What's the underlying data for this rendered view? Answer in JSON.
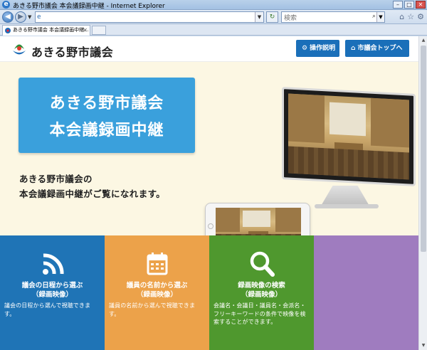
{
  "window": {
    "title": "あきる野市議会 本会議録画中継 - Internet Explorer",
    "buttons": {
      "minimize": "–",
      "maximize": "□",
      "close": "✕"
    }
  },
  "toolbar": {
    "back_label": "◀",
    "forward_label": "▶",
    "address_value": "",
    "search_placeholder": "検索",
    "tab_title": "あきる野市議会 本会議録画中継...",
    "icons": [
      "home-icon",
      "favorites-star-icon",
      "gear-icon"
    ]
  },
  "site": {
    "name": "あきる野市議会",
    "help_button": "操作説明",
    "top_button": "市議会トップへ"
  },
  "hero": {
    "title_line1": "あきる野市議会",
    "title_line2": "本会議録画中継",
    "lead_line1": "あきる野市議会の",
    "lead_line2": "本会議録画中継がご覧になれます。"
  },
  "tiles": [
    {
      "heading_line1": "議会の日程から選ぶ",
      "heading_line2": "（録画映像）",
      "description": "議会の日程から選んで視聴できます。",
      "color": "#1f74b6",
      "icon": "signal-icon"
    },
    {
      "heading_line1": "議員の名前から選ぶ",
      "heading_line2": "（録画映像）",
      "description": "議員の名前から選んで視聴できます。",
      "color": "#eca24a",
      "icon": "calendar-icon"
    },
    {
      "heading_line1": "録画映像の検索",
      "heading_line2": "（録画映像）",
      "description": "会議名・会議日・議員名・会派名・フリーキーワードの条件で映像を検索することができます。",
      "color": "#4f982e",
      "icon": "search-icon"
    },
    {
      "heading_line1": "",
      "heading_line2": "",
      "description": "",
      "color": "#9f7cbf",
      "icon": ""
    }
  ]
}
